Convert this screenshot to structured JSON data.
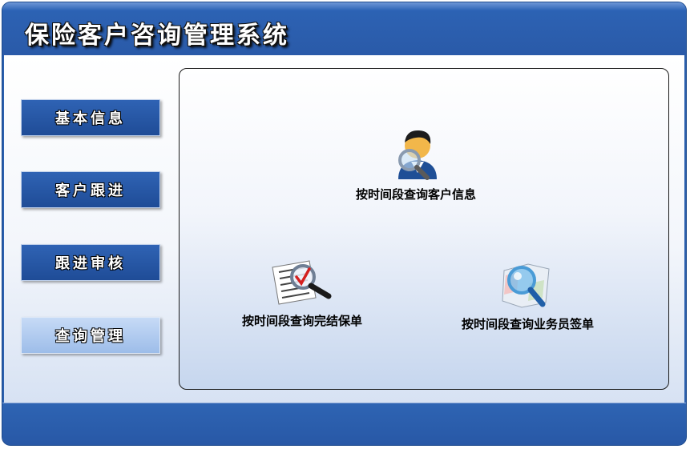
{
  "app": {
    "title": "保险客户咨询管理系统"
  },
  "sidebar": {
    "items": [
      {
        "label": "基本信息",
        "active": false
      },
      {
        "label": "客户跟进",
        "active": false
      },
      {
        "label": "跟进审核",
        "active": false
      },
      {
        "label": "查询管理",
        "active": true
      }
    ]
  },
  "main": {
    "features": [
      {
        "label": "按时间段查询客户信息",
        "icon": "user-search-icon"
      },
      {
        "label": "按时间段查询完结保单",
        "icon": "document-check-search-icon"
      },
      {
        "label": "按时间段查询业务员签单",
        "icon": "map-search-icon"
      }
    ]
  },
  "colors": {
    "header": "#2a5fae",
    "active_nav": "#a9c6ee",
    "nav": "#2657a6"
  }
}
